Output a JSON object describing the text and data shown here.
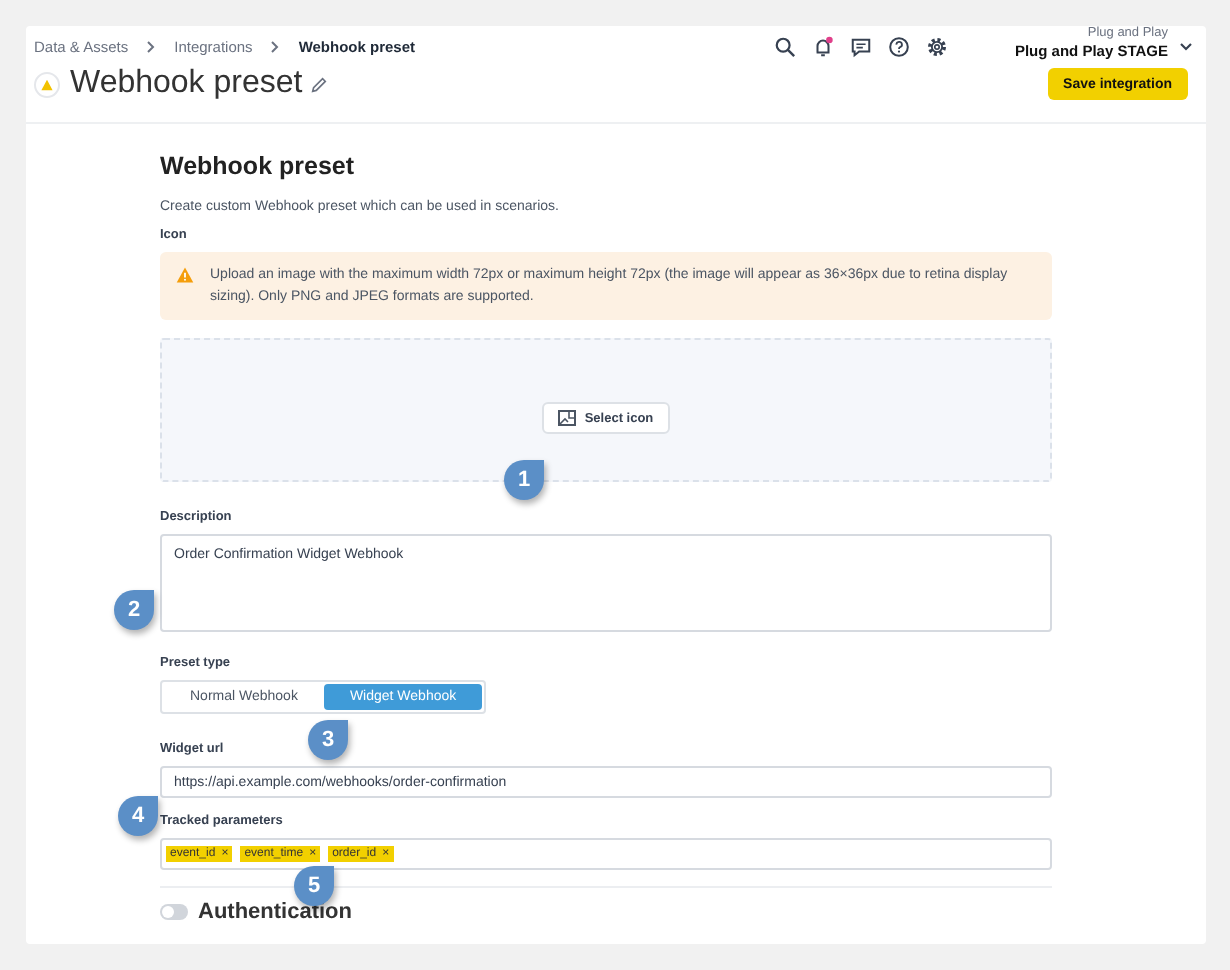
{
  "breadcrumbs": [
    {
      "label": "Data & Assets",
      "current": false
    },
    {
      "label": "Integrations",
      "current": false
    },
    {
      "label": "Webhook preset",
      "current": true
    }
  ],
  "header": {
    "notifications_unread": true,
    "account_org": "Plug and Play",
    "account_name": "Plug and Play STAGE"
  },
  "page": {
    "title": "Webhook preset",
    "save_button": "Save integration"
  },
  "form": {
    "heading": "Webhook preset",
    "intro": "Create custom Webhook preset which can be used in scenarios.",
    "icon_label": "Icon",
    "warning": "Upload an image with the maximum width 72px or maximum height 72px (the image will appear as 36×36px due to retina display sizing). Only PNG and JPEG formats are supported.",
    "select_icon_button": "Select icon",
    "description_label": "Description",
    "description_value": "Order Confirmation Widget Webhook",
    "preset_type_label": "Preset type",
    "preset_types": [
      {
        "label": "Normal Webhook",
        "selected": false
      },
      {
        "label": "Widget Webhook",
        "selected": true
      }
    ],
    "widget_url_label": "Widget url",
    "widget_url_value": "https://api.example.com/webhooks/order-confirmation",
    "tracked_parameters_label": "Tracked parameters",
    "tracked_parameters": [
      {
        "label": "event_id",
        "remove": "×"
      },
      {
        "label": "event_time",
        "remove": "×"
      },
      {
        "label": "order_id",
        "remove": "×"
      }
    ],
    "authentication": {
      "label": "Authentication",
      "on": false
    }
  },
  "callouts": [
    {
      "label": "1"
    },
    {
      "label": "2"
    },
    {
      "label": "3"
    },
    {
      "label": "4"
    },
    {
      "label": "5"
    }
  ]
}
